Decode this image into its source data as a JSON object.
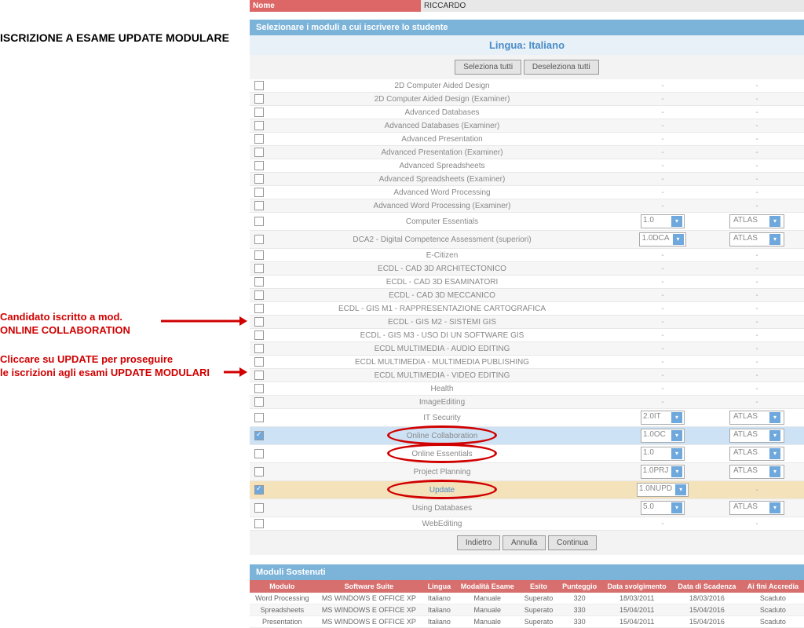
{
  "top": {
    "nome_label": "Nome",
    "nome_value": "RICCARDO"
  },
  "left": {
    "title": "ISCRIZIONE A ESAME UPDATE MODULARE",
    "ann1_l1": "Candidato iscritto a mod.",
    "ann1_l2": "ONLINE COLLABORATION",
    "ann2_l1": "Cliccare su UPDATE per proseguire",
    "ann2_l2": "le iscrizioni agli esami UPDATE MODULARI"
  },
  "section_title": "Selezionare i moduli a cui iscrivere lo studente",
  "lingua": "Lingua: Italiano",
  "btn_sel_all": "Seleziona tutti",
  "btn_desel_all": "Deseleziona tutti",
  "btn_indietro": "Indietro",
  "btn_annulla": "Annulla",
  "btn_continua": "Continua",
  "atlas": "ATLAS",
  "modules": [
    {
      "name": "2D Computer Aided Design"
    },
    {
      "name": "2D Computer Aided Design (Examiner)"
    },
    {
      "name": "Advanced Databases"
    },
    {
      "name": "Advanced Databases (Examiner)"
    },
    {
      "name": "Advanced Presentation"
    },
    {
      "name": "Advanced Presentation (Examiner)"
    },
    {
      "name": "Advanced Spreadsheets"
    },
    {
      "name": "Advanced Spreadsheets (Examiner)"
    },
    {
      "name": "Advanced Word Processing"
    },
    {
      "name": "Advanced Word Processing (Examiner)"
    },
    {
      "name": "Computer Essentials",
      "sel": "1.0",
      "atlas": true
    },
    {
      "name": "DCA2 - Digital Competence Assessment (superiori)",
      "sel": "1.0DCA",
      "atlas": true
    },
    {
      "name": "E-Citizen"
    },
    {
      "name": "ECDL - CAD 3D ARCHITECTONICO"
    },
    {
      "name": "ECDL - CAD 3D ESAMINATORI"
    },
    {
      "name": "ECDL - CAD 3D MECCANICO"
    },
    {
      "name": "ECDL - GIS M1 - RAPPRESENTAZIONE CARTOGRAFICA"
    },
    {
      "name": "ECDL - GIS M2 - SISTEMI GIS"
    },
    {
      "name": "ECDL - GIS M3 - USO DI UN SOFTWARE GIS"
    },
    {
      "name": "ECDL MULTIMEDIA - AUDIO EDITING"
    },
    {
      "name": "ECDL MULTIMEDIA - MULTIMEDIA PUBLISHING"
    },
    {
      "name": "ECDL MULTIMEDIA - VIDEO EDITING"
    },
    {
      "name": "Health"
    },
    {
      "name": "ImageEditing"
    },
    {
      "name": "IT Security",
      "sel": "2.0IT",
      "atlas": true
    },
    {
      "name": "Online Collaboration",
      "sel": "1.0OC",
      "atlas": true,
      "checked": true,
      "link": true,
      "ellipse": true
    },
    {
      "name": "Online Essentials",
      "sel": "1.0",
      "atlas": true,
      "link": true,
      "ellipse": true
    },
    {
      "name": "Project Planning",
      "sel": "1.0PRJ",
      "atlas": true
    },
    {
      "name": "Update",
      "sel": "1.0NUPD",
      "checked": true,
      "update_row": true,
      "link": true,
      "ellipse": true
    },
    {
      "name": "Using Databases",
      "sel": "5.0",
      "atlas": true
    },
    {
      "name": "WebEditing"
    }
  ],
  "sostenuti_title": "Moduli Sostenuti",
  "sost_headers": [
    "Modulo",
    "Software Suite",
    "Lingua",
    "Modalità Esame",
    "Esito",
    "Punteggio",
    "Data svolgimento",
    "Data di Scadenza",
    "Ai fini Accredia"
  ],
  "sost_rows": [
    [
      "Word Processing",
      "MS WINDOWS E OFFICE XP",
      "Italiano",
      "Manuale",
      "Superato",
      "320",
      "18/03/2011",
      "18/03/2016",
      "Scaduto"
    ],
    [
      "Spreadsheets",
      "MS WINDOWS E OFFICE XP",
      "Italiano",
      "Manuale",
      "Superato",
      "330",
      "15/04/2011",
      "15/04/2016",
      "Scaduto"
    ],
    [
      "Presentation",
      "MS WINDOWS E OFFICE XP",
      "Italiano",
      "Manuale",
      "Superato",
      "330",
      "15/04/2011",
      "15/04/2016",
      "Scaduto"
    ]
  ]
}
